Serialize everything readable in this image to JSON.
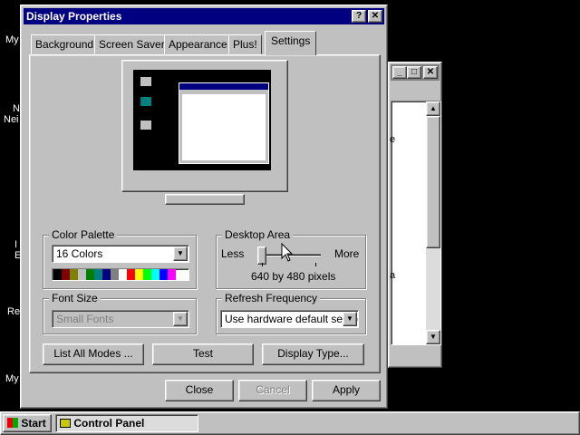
{
  "desktop": {
    "labels": [
      "My",
      "N",
      "Nei",
      "I",
      "E",
      "Re",
      "My"
    ]
  },
  "bg_window": {
    "buttons": {
      "minimize": "_",
      "maximize": "□",
      "close": "✕"
    },
    "text_fragments": [
      "e",
      "a"
    ]
  },
  "dialog": {
    "title": "Display Properties",
    "help_button": "?",
    "close_button": "✕",
    "tabs": [
      "Background",
      "Screen Saver",
      "Appearance",
      "Plus!",
      "Settings"
    ],
    "active_tab": "Settings",
    "color_palette": {
      "label": "Color Palette",
      "value": "16 Colors",
      "swatches": [
        "#000000",
        "#800000",
        "#808000",
        "#c0c0c0",
        "#008000",
        "#008080",
        "#000080",
        "#808080",
        "#ffffff",
        "#ff0000",
        "#ffff00",
        "#00ff00",
        "#00ffff",
        "#0000ff",
        "#ff00ff"
      ]
    },
    "desktop_area": {
      "label": "Desktop Area",
      "less": "Less",
      "more": "More",
      "resolution": "640 by 480 pixels",
      "slider_position": 0
    },
    "font_size": {
      "label": "Font Size",
      "value": "Small Fonts"
    },
    "refresh_frequency": {
      "label": "Refresh Frequency",
      "value": "Use hardware default setting"
    },
    "buttons": {
      "list_all_modes": "List All Modes ...",
      "test": "Test",
      "display_type": "Display Type...",
      "close": "Close",
      "cancel": "Cancel",
      "apply": "Apply"
    }
  },
  "taskbar": {
    "start": "Start",
    "task": "Control Panel"
  }
}
